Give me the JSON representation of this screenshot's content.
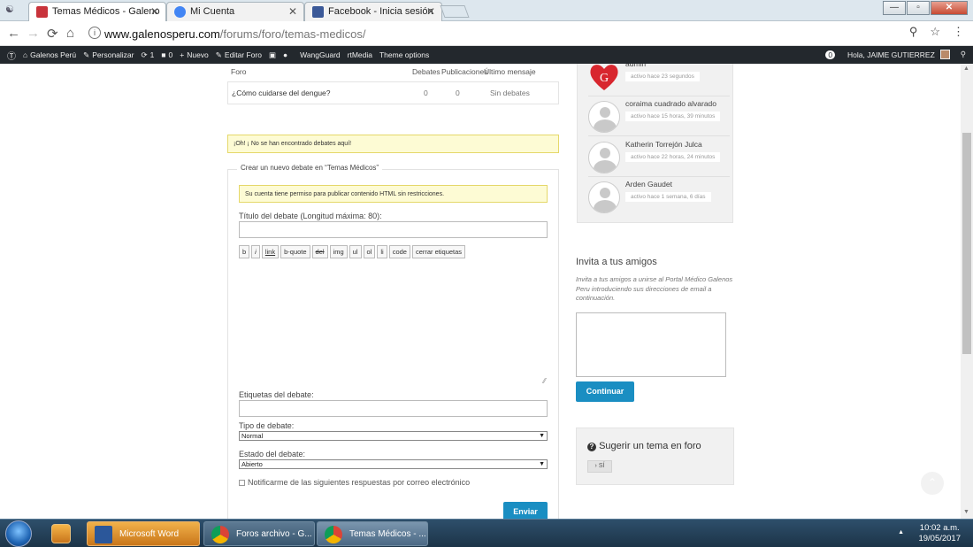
{
  "browser": {
    "tabs": [
      {
        "title": "Temas Médicos - Galeno",
        "active": true
      },
      {
        "title": "Mi Cuenta",
        "active": false
      },
      {
        "title": "Facebook - Inicia sesión",
        "active": false
      }
    ],
    "url_host": "www.galenosperu.com",
    "url_path": "/forums/foro/temas-medicos/"
  },
  "wp_admin_bar": {
    "site_name": "Galenos Perú",
    "customize": "Personalizar",
    "updates_count": "1",
    "comments_count": "0",
    "new": "Nuevo",
    "edit": "Editar Foro",
    "wangguard": "WangGuard",
    "rtmedia": "rtMedia",
    "theme_options": "Theme options",
    "notif_count": "0",
    "greeting": "Hola, JAIME GUTIERREZ"
  },
  "forum_table": {
    "headers": [
      "Foro",
      "Debates",
      "Publicaciones",
      "Último mensaje"
    ],
    "rows": [
      {
        "forum": "¿Cómo cuidarse del dengue?",
        "debates": "0",
        "posts": "0",
        "last": "Sin debates"
      }
    ]
  },
  "notice_no_debates": "¡Oh! ¡ No se han encontrado debates aquí!",
  "new_topic_form": {
    "legend": "Crear un nuevo debate en “Temas Médicos”",
    "html_notice": "Su cuenta tiene permiso para publicar contenido HTML sin restricciones.",
    "title_label": "Título del debate (Longitud máxima: 80):",
    "quicktags": [
      "b",
      "i",
      "link",
      "b-quote",
      "del",
      "img",
      "ul",
      "ol",
      "li",
      "code",
      "cerrar etiquetas"
    ],
    "tags_label": "Etiquetas del debate:",
    "type_label": "Tipo de debate:",
    "type_value": "Normal",
    "status_label": "Estado del debate:",
    "status_value": "Abierto",
    "notify_label": "Notificarme de las siguientes respuestas por correo electrónico",
    "submit": "Enviar"
  },
  "members": [
    {
      "name": "admin",
      "activity": "activo hace 23 segundos"
    },
    {
      "name": "coraima cuadrado alvarado",
      "activity": "activo hace 15 horas, 39 minutos"
    },
    {
      "name": "Katherin Torrejón Julca",
      "activity": "activo hace 22 horas, 24 minutos"
    },
    {
      "name": "Arden Gaudet",
      "activity": "activo hace 1 semana, 6 días"
    }
  ],
  "invite": {
    "title": "Invita a tus amigos",
    "text": "Invita a tus amigos a unirse al Portal Médico Galenos Peru introduciendo sus direcciones de email a continuación.",
    "button": "Continuar"
  },
  "suggest": {
    "title": "Sugerir un tema en foro",
    "button": "› SÍ"
  },
  "taskbar": {
    "items": [
      "Microsoft Word",
      "Foros archivo - G...",
      "Temas Médicos - ..."
    ],
    "time": "10:02 a.m.",
    "date": "19/05/2017"
  },
  "colors": {
    "accent": "#1a8ec2",
    "wpbar": "#23282d",
    "notice_bg": "#fdfbd4"
  }
}
